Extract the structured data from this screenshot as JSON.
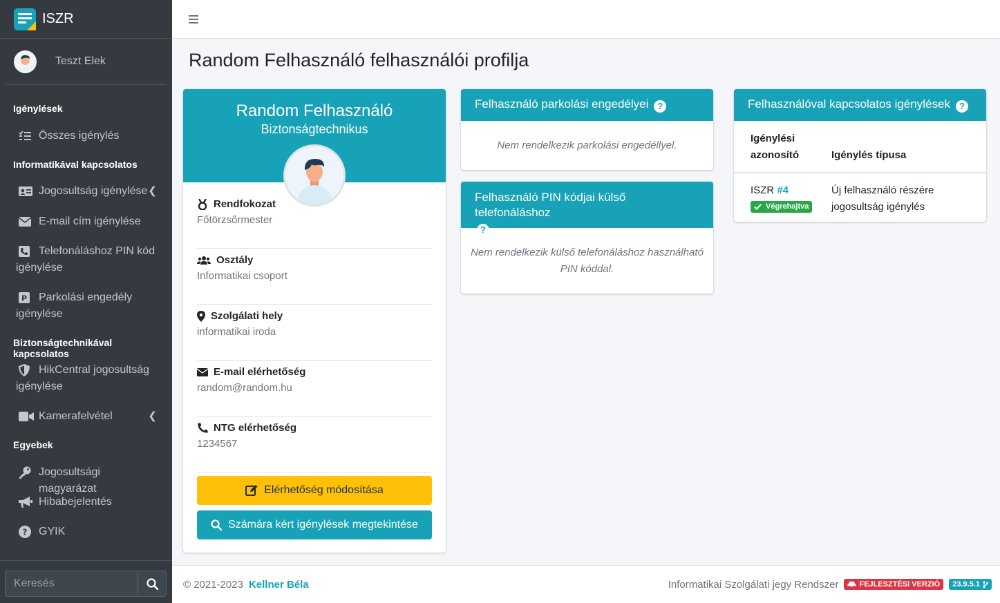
{
  "app": {
    "title": "ISZR"
  },
  "user": {
    "name": "Teszt Elek"
  },
  "sidebar": {
    "sections": [
      {
        "header": "Igénylések"
      },
      {
        "header": "Informatikával kapcsolatos"
      },
      {
        "header": "Biztonságtechnikával kapcsolatos"
      },
      {
        "header": "Egyebek"
      }
    ],
    "items": [
      {
        "label": "Összes igénylés",
        "icon": "list-check-icon"
      },
      {
        "label": "Jogosultság igénylése",
        "icon": "id-card-icon"
      },
      {
        "label": "E-mail cím igénylése",
        "icon": "envelope-icon"
      },
      {
        "label": "Telefonáláshoz PIN kód",
        "label2": "igénylése",
        "icon": "phone-square-icon"
      },
      {
        "label": "Parkolási engedély",
        "label2": "igénylése",
        "icon": "parking-icon"
      },
      {
        "label": "HikCentral jogosultság",
        "label2": "igénylése",
        "icon": "shield-icon"
      },
      {
        "label": "Kamerafelvétel",
        "icon": "video-icon"
      },
      {
        "label": "Jogosultsági magyarázat",
        "icon": "key-icon"
      },
      {
        "label": "Hibabejelentés",
        "icon": "bullhorn-icon"
      },
      {
        "label": "GYIK",
        "icon": "question-circle-icon"
      }
    ],
    "search": {
      "placeholder": "Keresés"
    }
  },
  "page": {
    "title": "Random Felhasználó felhasználói profilja"
  },
  "profile": {
    "name": "Random Felhasználó",
    "role": "Biztonságtechnikus",
    "fields": [
      {
        "label": "Rendfokozat",
        "value": "Főtörzsőrmester",
        "icon": "medal-icon"
      },
      {
        "label": "Osztály",
        "value": "Informatikai csoport",
        "icon": "users-icon"
      },
      {
        "label": "Szolgálati hely",
        "value": "informatikai iroda",
        "icon": "map-marker-icon"
      },
      {
        "label": "E-mail elérhetőség",
        "value": "random@random.hu",
        "icon": "envelope-icon"
      },
      {
        "label": "NTG elérhetőség",
        "value": "1234567",
        "icon": "phone-icon"
      }
    ],
    "edit_button": "Elérhetőség módosítása",
    "view_button": "Számára kért igénylések megtekintése"
  },
  "parking": {
    "title": "Felhasználó parkolási engedélyei",
    "empty": "Nem rendelkezik parkolási engedéllyel."
  },
  "pin": {
    "title": "Felhasználó PIN kódjai külső telefonáláshoz",
    "empty_line1": "Nem rendelkezik külső telefonáláshoz használható",
    "empty_line2": "PIN kóddal."
  },
  "requests": {
    "title": "Felhasználóval kapcsolatos igénylések",
    "col_id_line1": "Igénylési",
    "col_id_line2": "azonosító",
    "col_type": "Igénylés típusa",
    "rows": [
      {
        "prefix": "ISZR",
        "id": "#4",
        "status": "Végrehajtva",
        "type_line1": "Új felhasználó részére",
        "type_line2": "jogosultság igénylés"
      }
    ]
  },
  "footer": {
    "copyright": "© 2021-2023",
    "author": "Kellner Béla",
    "system": "Informatikai Szolgálati jegy Rendszer",
    "dev_badge": "FEJLESZTÉSI VERZIÓ",
    "version": "23.9.5.1"
  },
  "colors": {
    "sidebar": "#343a40",
    "accent": "#17a2b8",
    "warning": "#ffc107",
    "success": "#28a745",
    "danger": "#dc3545"
  }
}
